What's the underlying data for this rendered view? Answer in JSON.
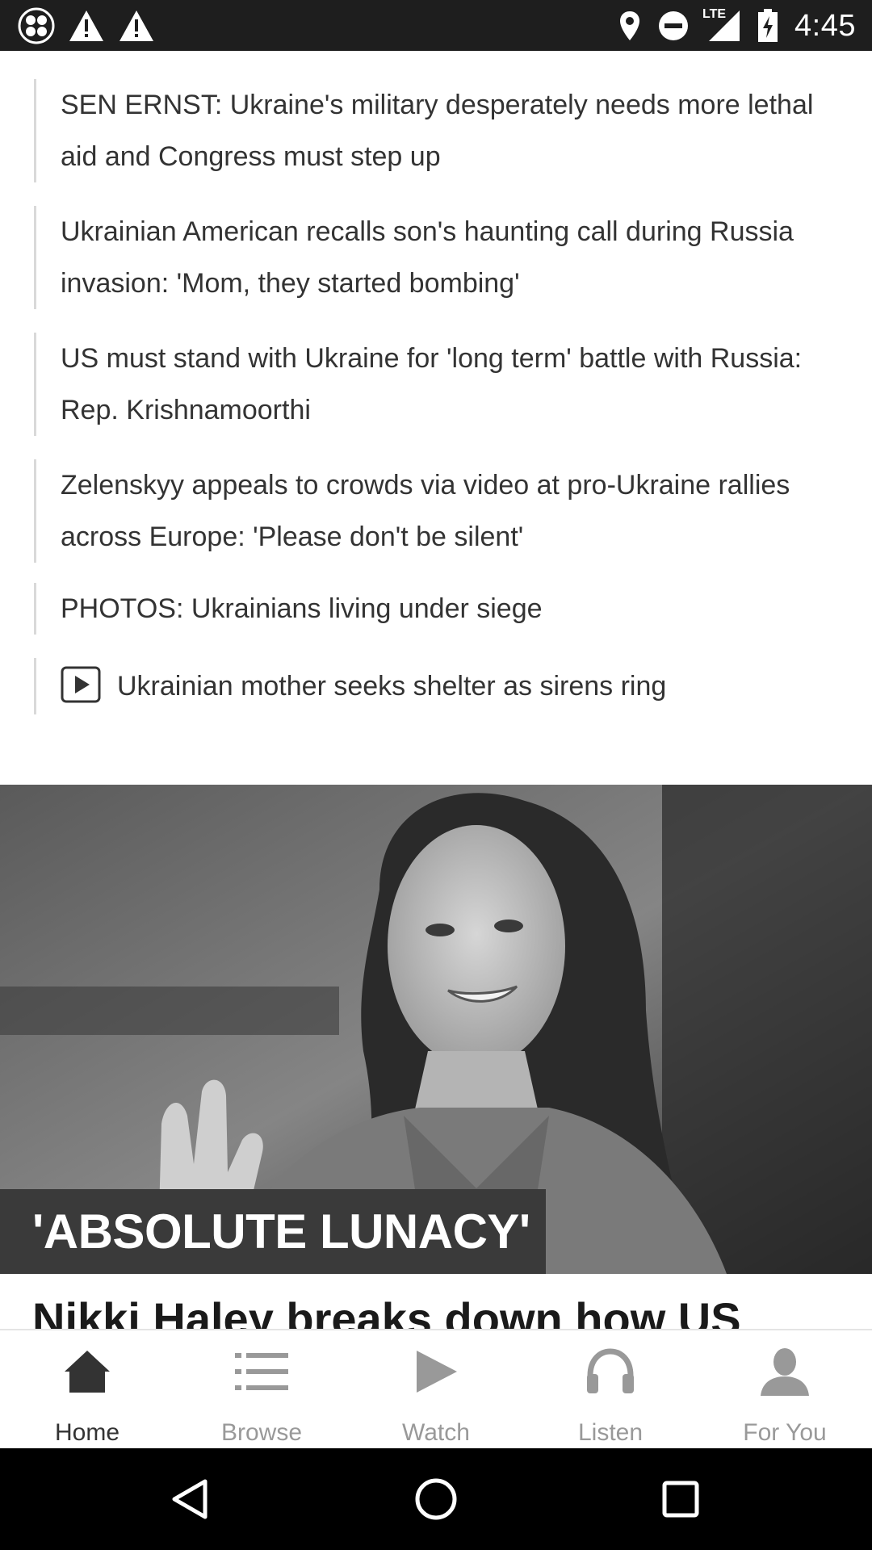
{
  "status_bar": {
    "time": "4:45",
    "network": "LTE",
    "left_icons": [
      "app-icon",
      "warning-icon",
      "warning-icon"
    ],
    "right_icons": [
      "location-icon",
      "dnd-icon",
      "signal-icon",
      "battery-charging-icon"
    ]
  },
  "related": [
    {
      "text": "SEN ERNST: Ukraine's military desperately needs more lethal aid and Congress must step up",
      "video": false
    },
    {
      "text": "Ukrainian American recalls son's haunting call during Russia invasion: 'Mom, they started bombing'",
      "video": false
    },
    {
      "text": "US must stand with Ukraine for 'long term' battle with Russia: Rep. Krishnamoorthi",
      "video": false
    },
    {
      "text": "Zelenskyy appeals to crowds via video at pro-Ukraine rallies across Europe: 'Please don't be silent'",
      "video": false
    },
    {
      "text": "PHOTOS: Ukrainians living under siege",
      "video": false
    },
    {
      "text": "Ukrainian mother seeks shelter as sirens ring",
      "video": true
    }
  ],
  "hero": {
    "label": "'ABSOLUTE LUNACY'",
    "headline": "Nikki Haley breaks down how US"
  },
  "bottom_nav": [
    {
      "label": "Home",
      "icon": "home-icon",
      "active": true
    },
    {
      "label": "Browse",
      "icon": "list-icon",
      "active": false
    },
    {
      "label": "Watch",
      "icon": "play-icon",
      "active": false
    },
    {
      "label": "Listen",
      "icon": "headphones-icon",
      "active": false
    },
    {
      "label": "For You",
      "icon": "person-icon",
      "active": false
    }
  ],
  "colors": {
    "status_bar_bg": "#1e1e1e",
    "text": "#333333",
    "nav_active": "#333333",
    "nav_inactive": "#999999",
    "hero_label_bg": "#3a3a3a"
  }
}
